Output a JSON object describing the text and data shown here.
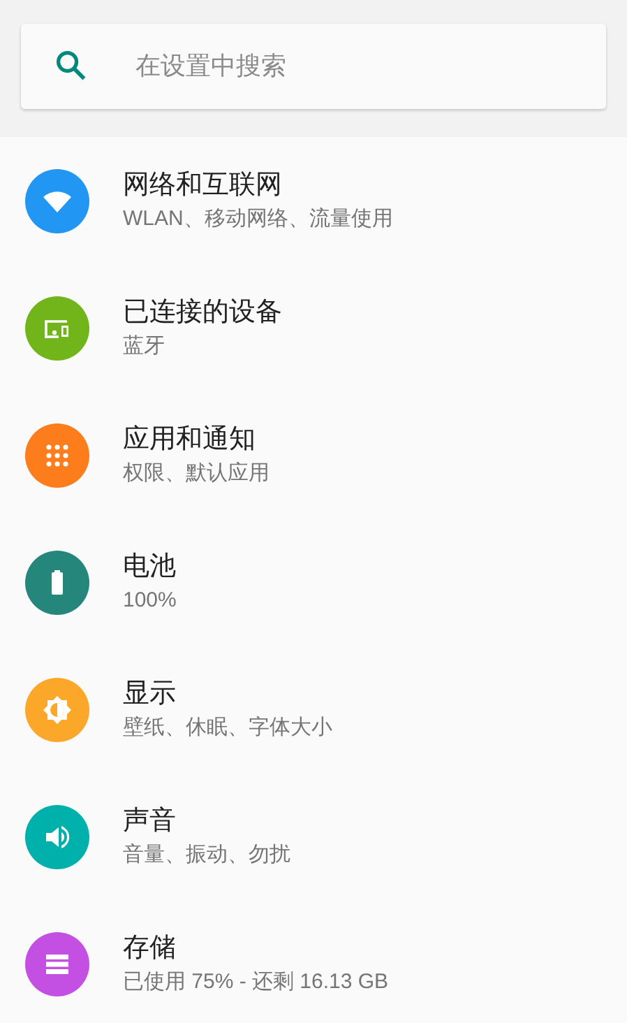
{
  "search": {
    "placeholder": "在设置中搜索"
  },
  "items": [
    {
      "kind": "wifi",
      "color": "#2196f3",
      "title": "网络和互联网",
      "subtitle": "WLAN、移动网络、流量使用"
    },
    {
      "kind": "devices",
      "color": "#72b51b",
      "title": "已连接的设备",
      "subtitle": "蓝牙"
    },
    {
      "kind": "apps",
      "color": "#fd7c1b",
      "title": "应用和通知",
      "subtitle": "权限、默认应用"
    },
    {
      "kind": "battery",
      "color": "#25877b",
      "title": "电池",
      "subtitle": "100%"
    },
    {
      "kind": "display",
      "color": "#fba72a",
      "title": "显示",
      "subtitle": "壁纸、休眠、字体大小"
    },
    {
      "kind": "sound",
      "color": "#00b0ab",
      "title": "声音",
      "subtitle": "音量、振动、勿扰"
    },
    {
      "kind": "storage",
      "color": "#c350e2",
      "title": "存储",
      "subtitle": "已使用 75% - 还剩 16.13 GB"
    }
  ]
}
